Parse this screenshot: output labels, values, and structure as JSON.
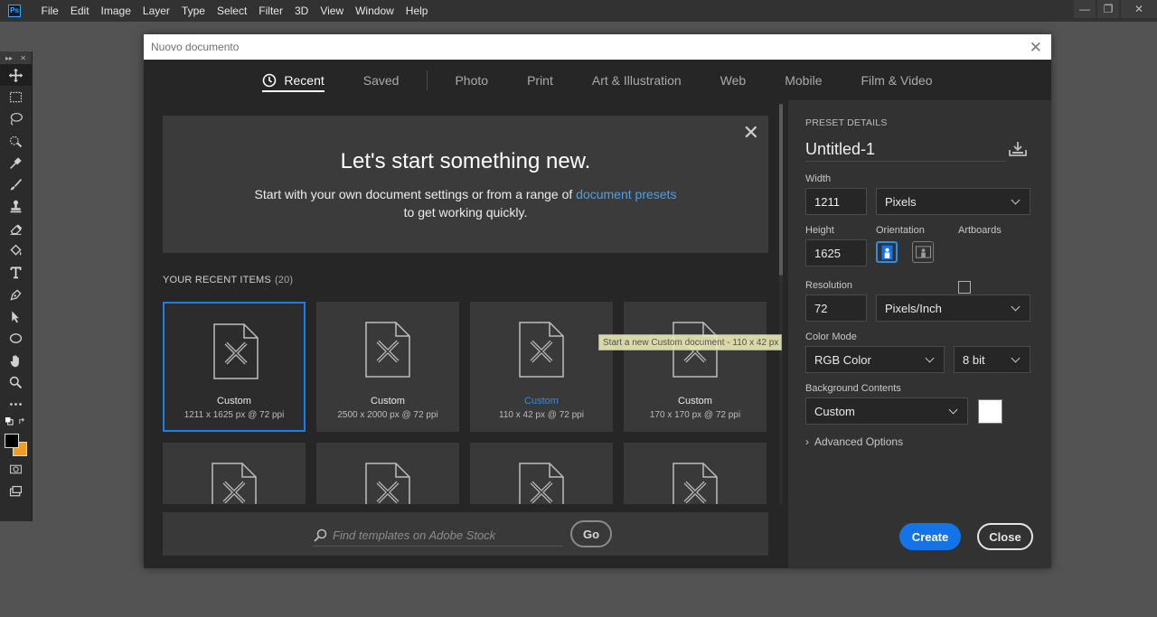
{
  "menubar": {
    "logo": "Ps",
    "items": [
      "File",
      "Edit",
      "Image",
      "Layer",
      "Type",
      "Select",
      "Filter",
      "3D",
      "View",
      "Window",
      "Help"
    ]
  },
  "window_controls": {
    "minimize": "—",
    "restore": "❐",
    "close": "✕"
  },
  "toolbar": {
    "header_left": "▸▸",
    "header_right": "✕",
    "tools": [
      "move-tool",
      "marquee-tool",
      "lasso-tool",
      "quick-selection-tool",
      "eyedropper-tool",
      "brush-tool",
      "stamp-tool",
      "eraser-tool",
      "paint-bucket-tool",
      "type-tool",
      "pen-tool",
      "path-selection-tool",
      "ellipse-tool",
      "hand-tool",
      "zoom-tool",
      "more-tools"
    ],
    "foreground_color": "#000000",
    "background_color": "#f39c24"
  },
  "dialog": {
    "title": "Nuovo documento",
    "tabs": [
      {
        "label": "Recent",
        "active": true
      },
      {
        "label": "Saved",
        "active": false
      },
      {
        "label": "Photo",
        "active": false
      },
      {
        "label": "Print",
        "active": false
      },
      {
        "label": "Art & Illustration",
        "active": false
      },
      {
        "label": "Web",
        "active": false
      },
      {
        "label": "Mobile",
        "active": false
      },
      {
        "label": "Film & Video",
        "active": false
      }
    ],
    "welcome": {
      "heading": "Let's start something new.",
      "line1_prefix": "Start with your own document settings or from a range of ",
      "line1_link": "document presets",
      "line2": "to get working quickly."
    },
    "recent": {
      "heading": "YOUR RECENT ITEMS",
      "count": "(20)",
      "items": [
        {
          "name": "Custom",
          "meta": "1211 x 1625 px @ 72 ppi"
        },
        {
          "name": "Custom",
          "meta": "2500 x 2000 px @ 72 ppi"
        },
        {
          "name": "Custom",
          "meta": "110 x 42 px @ 72 ppi"
        },
        {
          "name": "Custom",
          "meta": "170 x 170 px @ 72 ppi"
        },
        {
          "name": "",
          "meta": ""
        },
        {
          "name": "",
          "meta": ""
        },
        {
          "name": "",
          "meta": ""
        },
        {
          "name": "",
          "meta": ""
        }
      ]
    },
    "tooltip": "Start a new Custom document - 110 x 42 px",
    "stock": {
      "placeholder": "Find templates on Adobe Stock",
      "go_label": "Go"
    },
    "preset": {
      "section_label": "PRESET DETAILS",
      "name": "Untitled-1",
      "width_label": "Width",
      "width_value": "1211",
      "width_unit": "Pixels",
      "height_label": "Height",
      "height_value": "1625",
      "orientation_label": "Orientation",
      "artboards_label": "Artboards",
      "resolution_label": "Resolution",
      "resolution_value": "72",
      "resolution_unit": "Pixels/Inch",
      "color_mode_label": "Color Mode",
      "color_mode": "RGB Color",
      "bit_depth": "8 bit",
      "background_label": "Background Contents",
      "background_value": "Custom",
      "background_color": "#ffffff",
      "advanced_label": "Advanced Options",
      "create_label": "Create",
      "close_label": "Close"
    }
  }
}
